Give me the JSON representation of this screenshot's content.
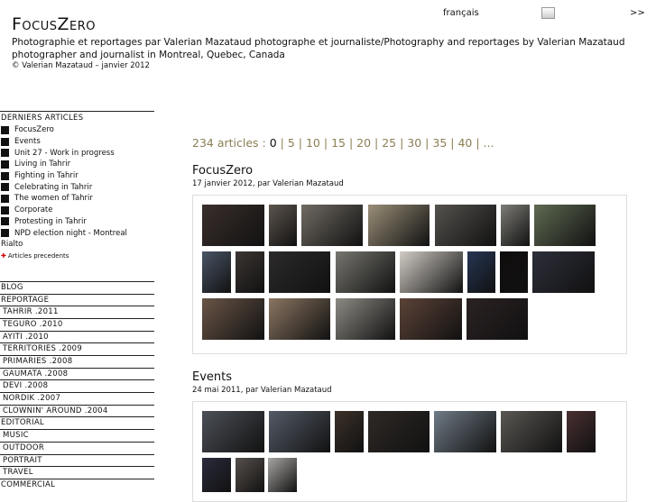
{
  "site": {
    "title": "FocusZero",
    "tagline": "Photographie et reportages par Valerian Mazataud photographe et journaliste/Photography and reportages by Valerian Mazataud photographer and journalist in Montreal, Quebec, Canada",
    "copyright": "© Valerian Mazataud – janvier 2012"
  },
  "lang": {
    "selected": "français",
    "next": ">>"
  },
  "sidebar": {
    "recent_heading": "DERNIERS ARTICLES",
    "recent": [
      "FocusZero",
      "Events",
      "Unit 27 - Work in progress",
      "Living in Tahrir",
      "Fighting in Tahrir",
      "Celebrating in Tahrir",
      "The women of Tahrir",
      "Corporate",
      "Protesting in Tahrir",
      "NPD election night - Montreal"
    ],
    "rialto": "Rialto",
    "previous": "Articles precedents",
    "nav": [
      {
        "label": "BLOG",
        "sub": false
      },
      {
        "label": "REPORTAGE",
        "sub": false
      },
      {
        "label": "TAHRIR .2011",
        "sub": true
      },
      {
        "label": "TEGURO .2010",
        "sub": true
      },
      {
        "label": "AYITI .2010",
        "sub": true
      },
      {
        "label": "TERRITORIES .2009",
        "sub": true
      },
      {
        "label": "PRIMARIES .2008",
        "sub": true
      },
      {
        "label": "GAUMATA .2008",
        "sub": true
      },
      {
        "label": "DEVI .2008",
        "sub": true
      },
      {
        "label": "NORDIK .2007",
        "sub": true
      },
      {
        "label": "CLOWNIN' AROUND .2004",
        "sub": true
      },
      {
        "label": "EDITORIAL",
        "sub": false
      },
      {
        "label": "MUSIC",
        "sub": true
      },
      {
        "label": "OUTDOOR",
        "sub": true
      },
      {
        "label": "PORTRAIT",
        "sub": true
      },
      {
        "label": "TRAVEL",
        "sub": true
      },
      {
        "label": "COMMERCIAL",
        "sub": false
      }
    ]
  },
  "pagination": {
    "count_label": "234 articles :",
    "current": "0",
    "pages": [
      "5",
      "10",
      "15",
      "20",
      "25",
      "30",
      "35",
      "40",
      "..."
    ]
  },
  "posts": [
    {
      "title": "FocusZero",
      "meta": "17 janvier 2012, par Valerian Mazataud",
      "thumbs": [
        {
          "tone": "#3a2f2b"
        },
        {
          "tone": "#5d554e"
        },
        {
          "tone": "#706b63"
        },
        {
          "tone": "#9a8e78"
        },
        {
          "tone": "#55524e"
        },
        {
          "tone": "#7d7c76"
        },
        {
          "tone": "#5f6a52"
        },
        {
          "tone": "#4a5566"
        },
        {
          "tone": "#3b3633"
        },
        {
          "tone": "#2c2a2a"
        },
        {
          "tone": "#777670"
        },
        {
          "tone": "#d2cdc6"
        },
        {
          "tone": "#263553"
        },
        {
          "tone": "#100c0c"
        },
        {
          "tone": "#2d2f3a"
        },
        {
          "tone": "#6a5547"
        },
        {
          "tone": "#8a7561"
        },
        {
          "tone": "#8d8a84"
        },
        {
          "tone": "#5c4338"
        },
        {
          "tone": "#2b2223"
        }
      ]
    },
    {
      "title": "Events",
      "meta": "24 mai 2011, par Valerian Mazataud",
      "thumbs": [
        {
          "tone": "#4c5057"
        },
        {
          "tone": "#545b67"
        },
        {
          "tone": "#3c3129"
        },
        {
          "tone": "#2f2a27"
        },
        {
          "tone": "#6f7b86"
        },
        {
          "tone": "#5a5753"
        },
        {
          "tone": "#4a3032"
        },
        {
          "tone": "#2b2b3d"
        },
        {
          "tone": "#56504c"
        },
        {
          "tone": "#a8a6a3"
        }
      ]
    }
  ]
}
